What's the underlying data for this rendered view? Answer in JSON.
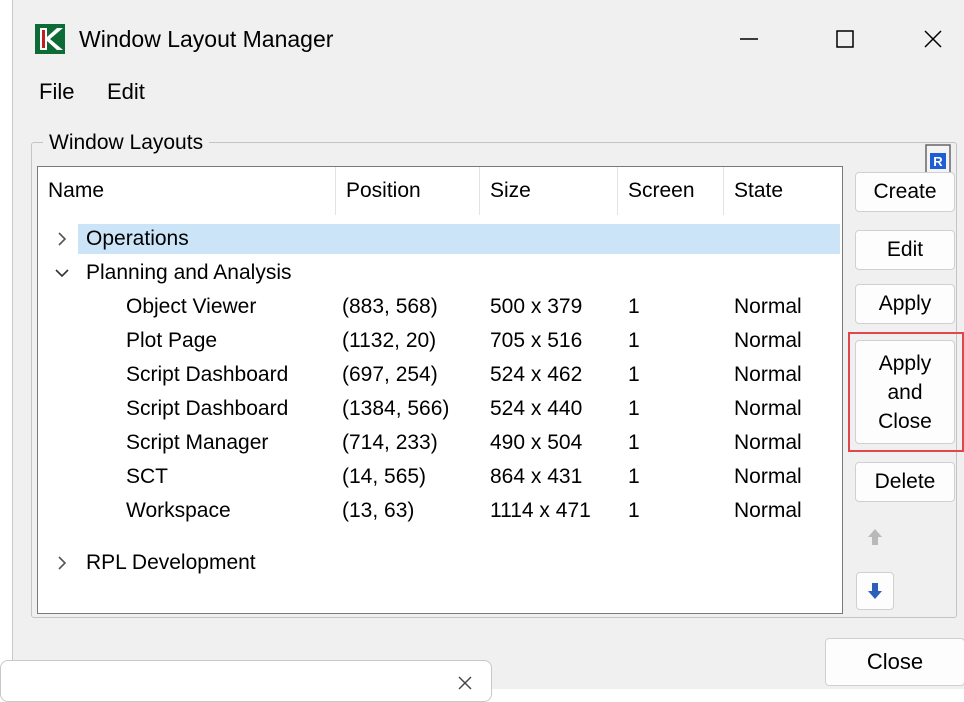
{
  "window": {
    "title": "Window Layout Manager"
  },
  "menu": {
    "file": "File",
    "edit": "Edit"
  },
  "group": {
    "label": "Window Layouts"
  },
  "columns": {
    "name": "Name",
    "position": "Position",
    "size": "Size",
    "screen": "Screen",
    "state": "State"
  },
  "tree": {
    "operations": "Operations",
    "planning": "Planning and Analysis",
    "rpl": "RPL Development",
    "rows": [
      {
        "name": "Object Viewer",
        "position": "(883, 568)",
        "size": "500 x 379",
        "screen": "1",
        "state": "Normal"
      },
      {
        "name": "Plot Page",
        "position": "(1132, 20)",
        "size": "705 x 516",
        "screen": "1",
        "state": "Normal"
      },
      {
        "name": "Script Dashboard",
        "position": "(697, 254)",
        "size": "524 x 462",
        "screen": "1",
        "state": "Normal"
      },
      {
        "name": "Script Dashboard",
        "position": "(1384, 566)",
        "size": "524 x 440",
        "screen": "1",
        "state": "Normal"
      },
      {
        "name": "Script Manager",
        "position": "(714, 233)",
        "size": "490 x 504",
        "screen": "1",
        "state": "Normal"
      },
      {
        "name": "SCT",
        "position": "(14, 565)",
        "size": "864 x 431",
        "screen": "1",
        "state": "Normal"
      },
      {
        "name": "Workspace",
        "position": "(13, 63)",
        "size": "1114 x 471",
        "screen": "1",
        "state": "Normal"
      }
    ]
  },
  "buttons": {
    "create": "Create",
    "edit": "Edit",
    "apply": "Apply",
    "apply_close": [
      "Apply",
      "and",
      "Close"
    ],
    "delete": "Delete",
    "close": "Close"
  },
  "icons": {
    "logo": "riverware-logo-icon",
    "help": "help-icon",
    "move_up": "arrow-up-icon",
    "move_down": "arrow-down-icon"
  },
  "colors": {
    "selection": "#cce4f7",
    "highlight_border": "#e0474c",
    "logo_green": "#107c41"
  }
}
